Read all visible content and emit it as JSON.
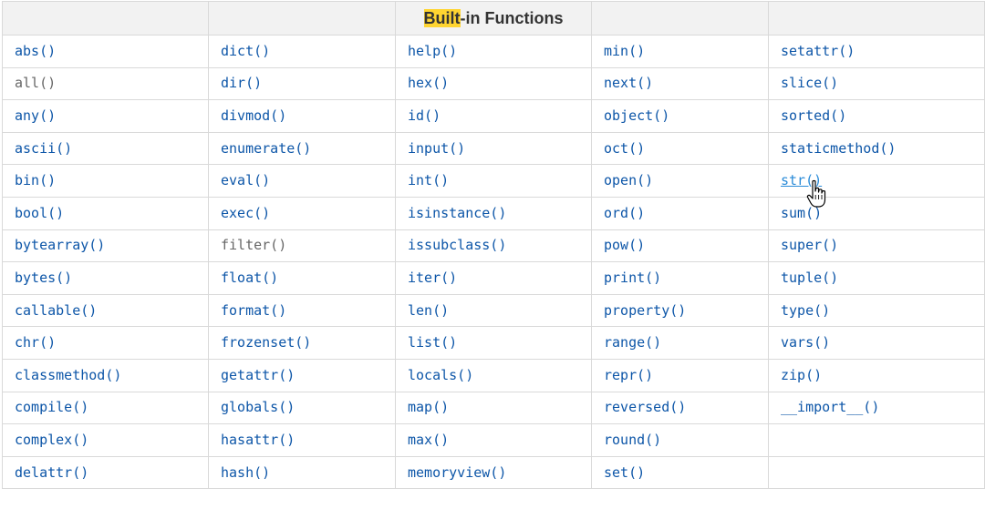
{
  "title": {
    "highlight": "Built",
    "rest": "-in Functions"
  },
  "colors": {
    "link": "#0d56a8",
    "link_hover": "#2a8bd8",
    "header_bg": "#f2f2f2",
    "highlight": "#ffd531",
    "border": "#d9d9d9"
  },
  "rows": [
    [
      "abs()",
      "dict()",
      "help()",
      "min()",
      "setattr()"
    ],
    [
      "all()",
      "dir()",
      "hex()",
      "next()",
      "slice()"
    ],
    [
      "any()",
      "divmod()",
      "id()",
      "object()",
      "sorted()"
    ],
    [
      "ascii()",
      "enumerate()",
      "input()",
      "oct()",
      "staticmethod()"
    ],
    [
      "bin()",
      "eval()",
      "int()",
      "open()",
      "str()"
    ],
    [
      "bool()",
      "exec()",
      "isinstance()",
      "ord()",
      "sum()"
    ],
    [
      "bytearray()",
      "filter()",
      "issubclass()",
      "pow()",
      "super()"
    ],
    [
      "bytes()",
      "float()",
      "iter()",
      "print()",
      "tuple()"
    ],
    [
      "callable()",
      "format()",
      "len()",
      "property()",
      "type()"
    ],
    [
      "chr()",
      "frozenset()",
      "list()",
      "range()",
      "vars()"
    ],
    [
      "classmethod()",
      "getattr()",
      "locals()",
      "repr()",
      "zip()"
    ],
    [
      "compile()",
      "globals()",
      "map()",
      "reversed()",
      "__import__()"
    ],
    [
      "complex()",
      "hasattr()",
      "max()",
      "round()",
      ""
    ],
    [
      "delattr()",
      "hash()",
      "memoryview()",
      "set()",
      ""
    ]
  ],
  "hovered_cell": "str()",
  "cursor_icon": "hand-pointer-icon"
}
